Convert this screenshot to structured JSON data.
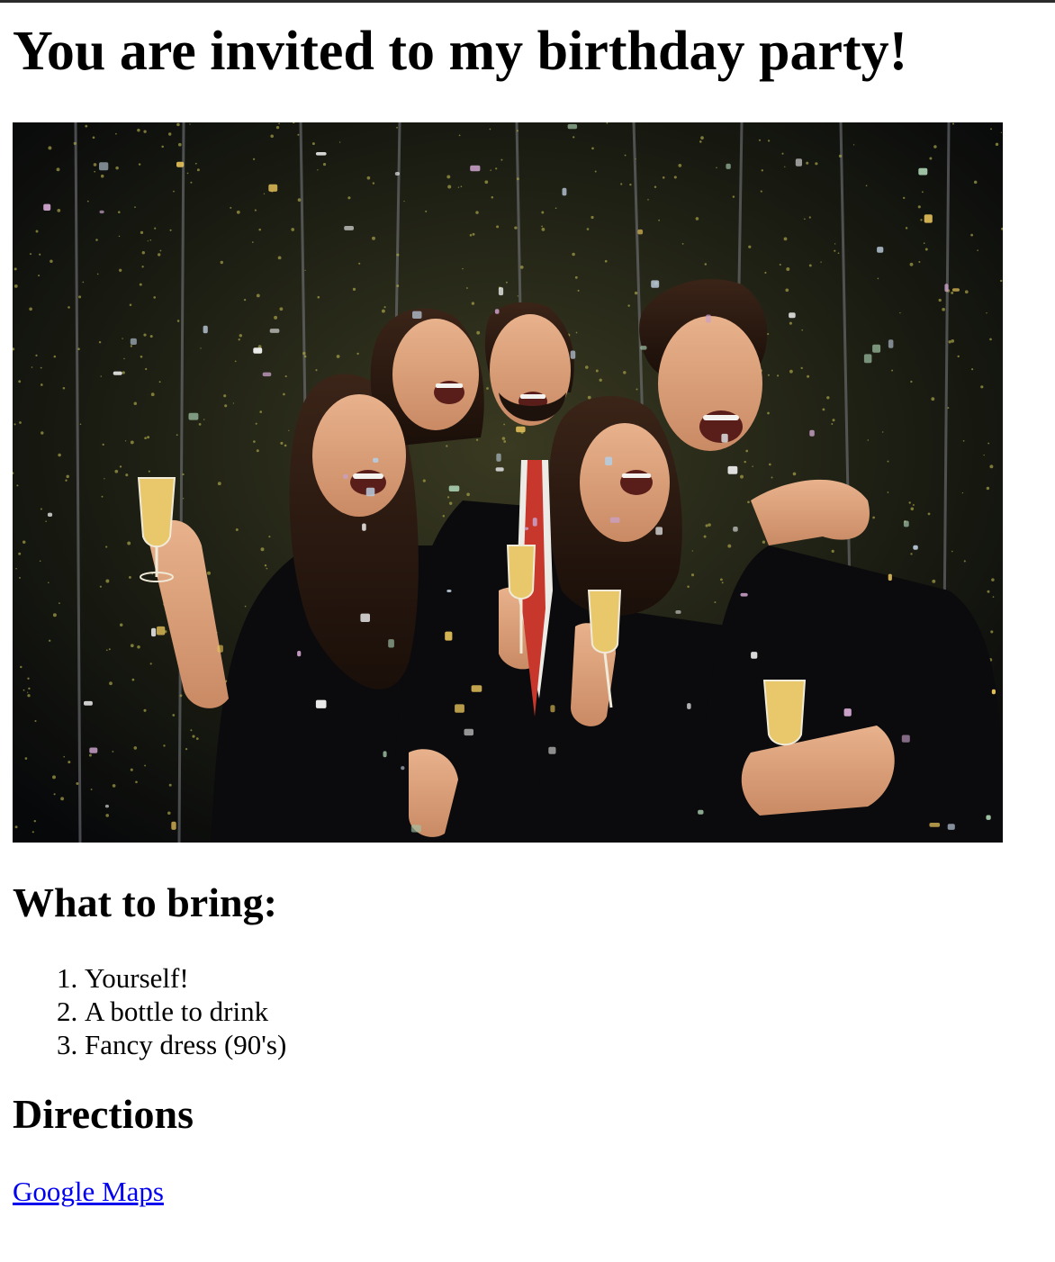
{
  "title": "You are invited to my birthday party!",
  "photo": {
    "description_icon": "party-photo",
    "colors": {
      "background": "#0d0f0a",
      "glitter": "#8f8a3a",
      "skin": "#d9a27e",
      "clothing": "#0a0a0a",
      "tie": "#c8372b",
      "champagne": "#e8c86a"
    }
  },
  "bring": {
    "heading": "What to bring:",
    "items": [
      "Yourself!",
      "A bottle to drink",
      "Fancy dress (90's)"
    ]
  },
  "directions": {
    "heading": "Directions",
    "link_label": "Google Maps"
  },
  "colors": {
    "link": "#0000ee",
    "text": "#000000",
    "top_border": "#2b2b2b"
  }
}
